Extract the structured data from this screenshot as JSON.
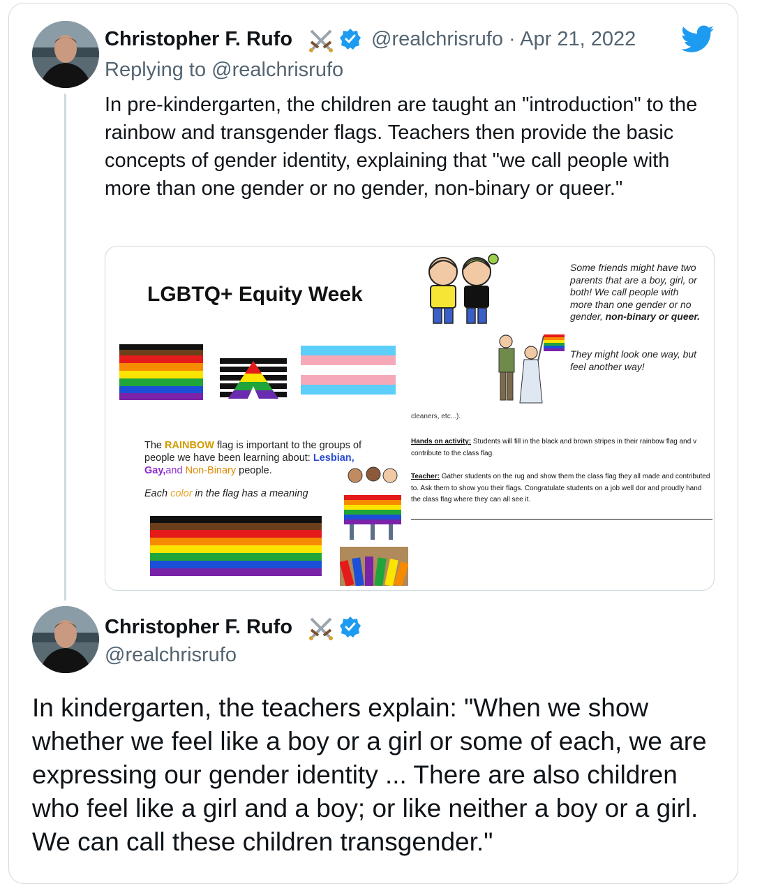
{
  "tweet1": {
    "display_name": "Christopher F. Rufo",
    "name_emoji": "⚔️",
    "handle_date": "@realchrisrufo · Apr 21, 2022",
    "replying_to": "Replying to @realchrisrufo",
    "text": "In pre-kindergarten, the children are taught an \"introduction\" to the rainbow and transgender flags. Teachers then provide the basic concepts of gender identity, explaining that \"we call people with more than one gender or no gender, non-binary or queer.\""
  },
  "media": {
    "slide_title": "LGBTQ+ Equity Week",
    "friends_text": "Some friends might have two parents that are a boy, girl, or both! We call people with more than one gender or no gender,",
    "friends_bold": "non-binary or queer.",
    "might_text": "They might look one way, but feel another way!",
    "rainbow_text": {
      "p1": "The ",
      "rainbow": "RAINBOW",
      "p2": " flag is important to the groups of people we have been learning about: ",
      "lesbian": "Lesbian,",
      "gay": "Gay,",
      "and": "and ",
      "nonbinary": "Non-Binary",
      "p3": " people."
    },
    "each_color": {
      "p1": "Each ",
      "color": "color",
      "p2": " in the flag has a meaning"
    },
    "cut_text": "cleaners, etc...).",
    "hands_on_label": "Hands on activity:",
    "hands_on_text": " Students will fill in the black and brown stripes in their rainbow flag and v contribute to the class flag.",
    "teacher_label": "Teacher:",
    "teacher_text": " Gather students on the rug and show them the class flag they all made and contributed to.  Ask them to show you their flags.  Congratulate students on a job well dor and proudly hand the class flag where they can all see it."
  },
  "tweet2": {
    "display_name": "Christopher F. Rufo",
    "name_emoji": "⚔️",
    "handle": "@realchrisrufo",
    "text": "In kindergarten, the teachers explain: \"When we show whether we feel like a boy or a girl or some of each, we are expressing our gender identity ... There are also children who feel like a girl and a boy; or like neither a boy or a girl. We can call these children transgender.\""
  },
  "icons": {
    "brand": "twitter-bird-icon",
    "verified": "verified-badge-icon",
    "emoji": "crossed-swords-icon"
  },
  "colors": {
    "twitter_blue": "#1d9bf0",
    "muted_text": "#536471",
    "border": "#cfd9de"
  }
}
